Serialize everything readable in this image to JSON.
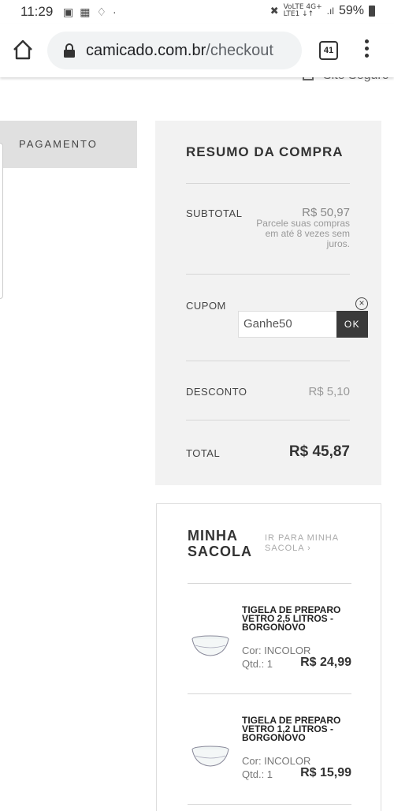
{
  "status_bar": {
    "time": "11:29",
    "network_top": "VoLTE 4G+",
    "network_bottom": "LTE1 ↓↑",
    "battery": "59%"
  },
  "browser": {
    "url_domain": "camicado.com.br",
    "url_path": "/checkout",
    "tab_count": "41"
  },
  "page": {
    "site_seguro": "Site Seguro",
    "step_label": "PAGAMENTO"
  },
  "summary": {
    "title": "RESUMO DA COMPRA",
    "subtotal_label": "SUBTOTAL",
    "subtotal_value": "R$ 50,97",
    "installments_note": "Parcele suas compras em até 8 vezes sem juros.",
    "coupon_label": "CUPOM",
    "coupon_value": "Ganhe50",
    "coupon_button": "OK",
    "discount_label": "DESCONTO",
    "discount_value": "R$ 5,10",
    "total_label": "TOTAL",
    "total_value": "R$ 45,87"
  },
  "bag": {
    "title": "MINHA SACOLA",
    "link": "IR PARA MINHA SACOLA ›",
    "items": [
      {
        "name": "TIGELA DE PREPARO VETRO 2,5 LITROS - BORGONOVO",
        "color": "Cor: INCOLOR",
        "qty": "Qtd.: 1",
        "price": "R$ 24,99"
      },
      {
        "name": "TIGELA DE PREPARO VETRO 1,2 LITROS - BORGONOVO",
        "color": "Cor: INCOLOR",
        "qty": "Qtd.: 1",
        "price": "R$ 15,99"
      }
    ]
  }
}
